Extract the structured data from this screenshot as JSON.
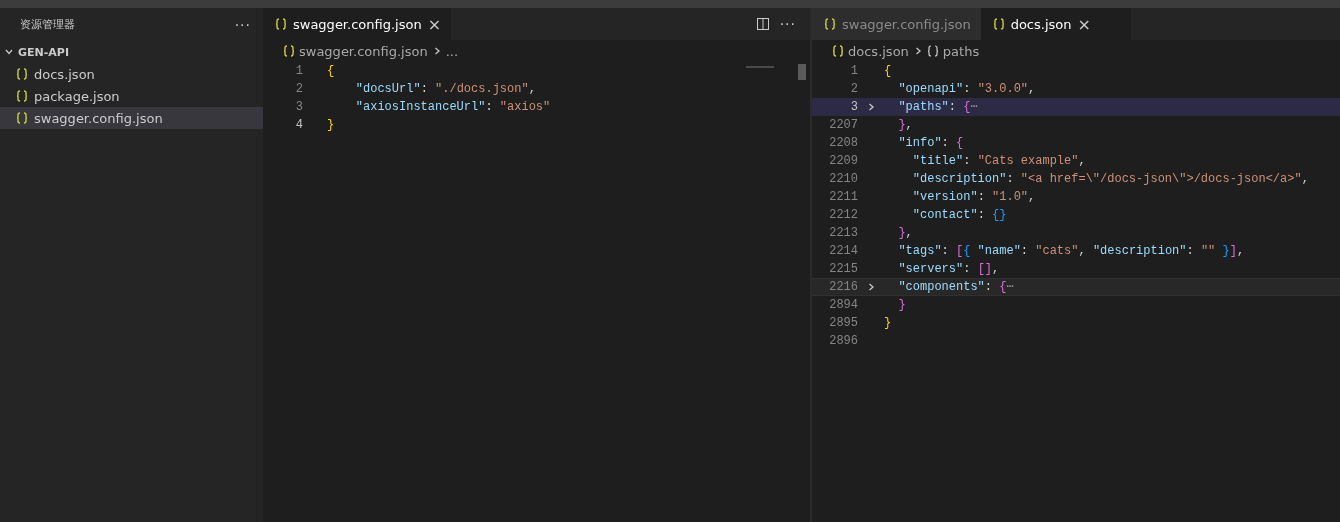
{
  "sidebar": {
    "title": "资源管理器",
    "more": "···",
    "folder": {
      "label": "GEN-API",
      "expanded": true,
      "files": [
        {
          "name": "docs.json",
          "selected": false
        },
        {
          "name": "package.json",
          "selected": false
        },
        {
          "name": "swagger.config.json",
          "selected": true
        }
      ]
    }
  },
  "editors": [
    {
      "tabs": [
        {
          "label": "swagger.config.json",
          "selected": true,
          "close": "×"
        }
      ],
      "more": "···",
      "breadcrumb": [
        {
          "label": "swagger.config.json",
          "kind": "file"
        },
        {
          "label": "...",
          "kind": "plain"
        }
      ],
      "lines": [
        {
          "number": "1",
          "current": false,
          "selected": false,
          "highlighted": false,
          "folded": false,
          "tokens": [
            {
              "t": "{",
              "kind": "b1"
            }
          ]
        },
        {
          "number": "2",
          "current": false,
          "selected": false,
          "highlighted": false,
          "folded": false,
          "tokens": [
            {
              "t": "    \"docsUrl\"",
              "kind": "key"
            },
            {
              "t": ": ",
              "kind": "p"
            },
            {
              "t": "\"./docs.json\"",
              "kind": "str"
            },
            {
              "t": ",",
              "kind": "p"
            }
          ]
        },
        {
          "number": "3",
          "current": false,
          "selected": false,
          "highlighted": false,
          "folded": false,
          "tokens": [
            {
              "t": "    \"axiosInstanceUrl\"",
              "kind": "key"
            },
            {
              "t": ": ",
              "kind": "p"
            },
            {
              "t": "\"axios\"",
              "kind": "str"
            }
          ]
        },
        {
          "number": "4",
          "current": true,
          "selected": false,
          "highlighted": false,
          "folded": false,
          "tokens": [
            {
              "t": "}",
              "kind": "b1"
            }
          ]
        }
      ]
    },
    {
      "tabs": [
        {
          "label": "swagger.config.json",
          "selected": false
        },
        {
          "label": "docs.json",
          "selected": true,
          "close": "×"
        }
      ],
      "breadcrumb": [
        {
          "label": "docs.json",
          "kind": "file"
        },
        {
          "label": "paths",
          "kind": "object"
        }
      ],
      "lines": [
        {
          "number": "1",
          "current": false,
          "selected": false,
          "highlighted": false,
          "folded": false,
          "tokens": [
            {
              "t": "{",
              "kind": "b1"
            }
          ]
        },
        {
          "number": "2",
          "current": false,
          "selected": false,
          "highlighted": false,
          "folded": false,
          "tokens": [
            {
              "t": "  \"openapi\"",
              "kind": "key"
            },
            {
              "t": ": ",
              "kind": "p"
            },
            {
              "t": "\"3.0.0\"",
              "kind": "str"
            },
            {
              "t": ",",
              "kind": "p"
            }
          ]
        },
        {
          "number": "3",
          "current": true,
          "selected": true,
          "highlighted": false,
          "folded": true,
          "tokens": [
            {
              "t": "  \"paths\"",
              "kind": "key"
            },
            {
              "t": ": ",
              "kind": "p"
            },
            {
              "t": "{",
              "kind": "b2"
            },
            {
              "t": "⋯",
              "kind": "fold"
            }
          ]
        },
        {
          "number": "2207",
          "current": false,
          "selected": false,
          "highlighted": false,
          "folded": false,
          "tokens": [
            {
              "t": "  }",
              "kind": "b2"
            },
            {
              "t": ",",
              "kind": "p"
            }
          ]
        },
        {
          "number": "2208",
          "current": false,
          "selected": false,
          "highlighted": false,
          "folded": false,
          "tokens": [
            {
              "t": "  \"info\"",
              "kind": "key"
            },
            {
              "t": ": ",
              "kind": "p"
            },
            {
              "t": "{",
              "kind": "b2"
            }
          ]
        },
        {
          "number": "2209",
          "current": false,
          "selected": false,
          "highlighted": false,
          "folded": false,
          "tokens": [
            {
              "t": "    \"title\"",
              "kind": "key"
            },
            {
              "t": ": ",
              "kind": "p"
            },
            {
              "t": "\"Cats example\"",
              "kind": "str"
            },
            {
              "t": ",",
              "kind": "p"
            }
          ]
        },
        {
          "number": "2210",
          "current": false,
          "selected": false,
          "highlighted": false,
          "folded": false,
          "tokens": [
            {
              "t": "    \"description\"",
              "kind": "key"
            },
            {
              "t": ": ",
              "kind": "p"
            },
            {
              "t": "\"<a href=\\\"/docs-json\\\">/docs-json</a>\"",
              "kind": "str"
            },
            {
              "t": ",",
              "kind": "p"
            }
          ]
        },
        {
          "number": "2211",
          "current": false,
          "selected": false,
          "highlighted": false,
          "folded": false,
          "tokens": [
            {
              "t": "    \"version\"",
              "kind": "key"
            },
            {
              "t": ": ",
              "kind": "p"
            },
            {
              "t": "\"1.0\"",
              "kind": "str"
            },
            {
              "t": ",",
              "kind": "p"
            }
          ]
        },
        {
          "number": "2212",
          "current": false,
          "selected": false,
          "highlighted": false,
          "folded": false,
          "tokens": [
            {
              "t": "    \"contact\"",
              "kind": "key"
            },
            {
              "t": ": ",
              "kind": "p"
            },
            {
              "t": "{}",
              "kind": "b3"
            }
          ]
        },
        {
          "number": "2213",
          "current": false,
          "selected": false,
          "highlighted": false,
          "folded": false,
          "tokens": [
            {
              "t": "  }",
              "kind": "b2"
            },
            {
              "t": ",",
              "kind": "p"
            }
          ]
        },
        {
          "number": "2214",
          "current": false,
          "selected": false,
          "highlighted": false,
          "folded": false,
          "tokens": [
            {
              "t": "  \"tags\"",
              "kind": "key"
            },
            {
              "t": ": ",
              "kind": "p"
            },
            {
              "t": "[",
              "kind": "b2"
            },
            {
              "t": "{",
              "kind": "b3"
            },
            {
              "t": " \"name\"",
              "kind": "key"
            },
            {
              "t": ": ",
              "kind": "p"
            },
            {
              "t": "\"cats\"",
              "kind": "str"
            },
            {
              "t": ", ",
              "kind": "p"
            },
            {
              "t": "\"description\"",
              "kind": "key"
            },
            {
              "t": ": ",
              "kind": "p"
            },
            {
              "t": "\"\"",
              "kind": "str"
            },
            {
              "t": " }",
              "kind": "b3"
            },
            {
              "t": "]",
              "kind": "b2"
            },
            {
              "t": ",",
              "kind": "p"
            }
          ]
        },
        {
          "number": "2215",
          "current": false,
          "selected": false,
          "highlighted": false,
          "folded": false,
          "tokens": [
            {
              "t": "  \"servers\"",
              "kind": "key"
            },
            {
              "t": ": ",
              "kind": "p"
            },
            {
              "t": "[]",
              "kind": "b2"
            },
            {
              "t": ",",
              "kind": "p"
            }
          ]
        },
        {
          "number": "2216",
          "current": false,
          "selected": false,
          "highlighted": true,
          "folded": true,
          "tokens": [
            {
              "t": "  \"components\"",
              "kind": "key"
            },
            {
              "t": ": ",
              "kind": "p"
            },
            {
              "t": "{",
              "kind": "b2"
            },
            {
              "t": "⋯",
              "kind": "fold"
            }
          ]
        },
        {
          "number": "2894",
          "current": false,
          "selected": false,
          "highlighted": false,
          "folded": false,
          "tokens": [
            {
              "t": "  }",
              "kind": "b2"
            }
          ]
        },
        {
          "number": "2895",
          "current": false,
          "selected": false,
          "highlighted": false,
          "folded": false,
          "tokens": [
            {
              "t": "}",
              "kind": "b1"
            }
          ]
        },
        {
          "number": "2896",
          "current": false,
          "selected": false,
          "highlighted": false,
          "folded": false
        }
      ]
    }
  ]
}
